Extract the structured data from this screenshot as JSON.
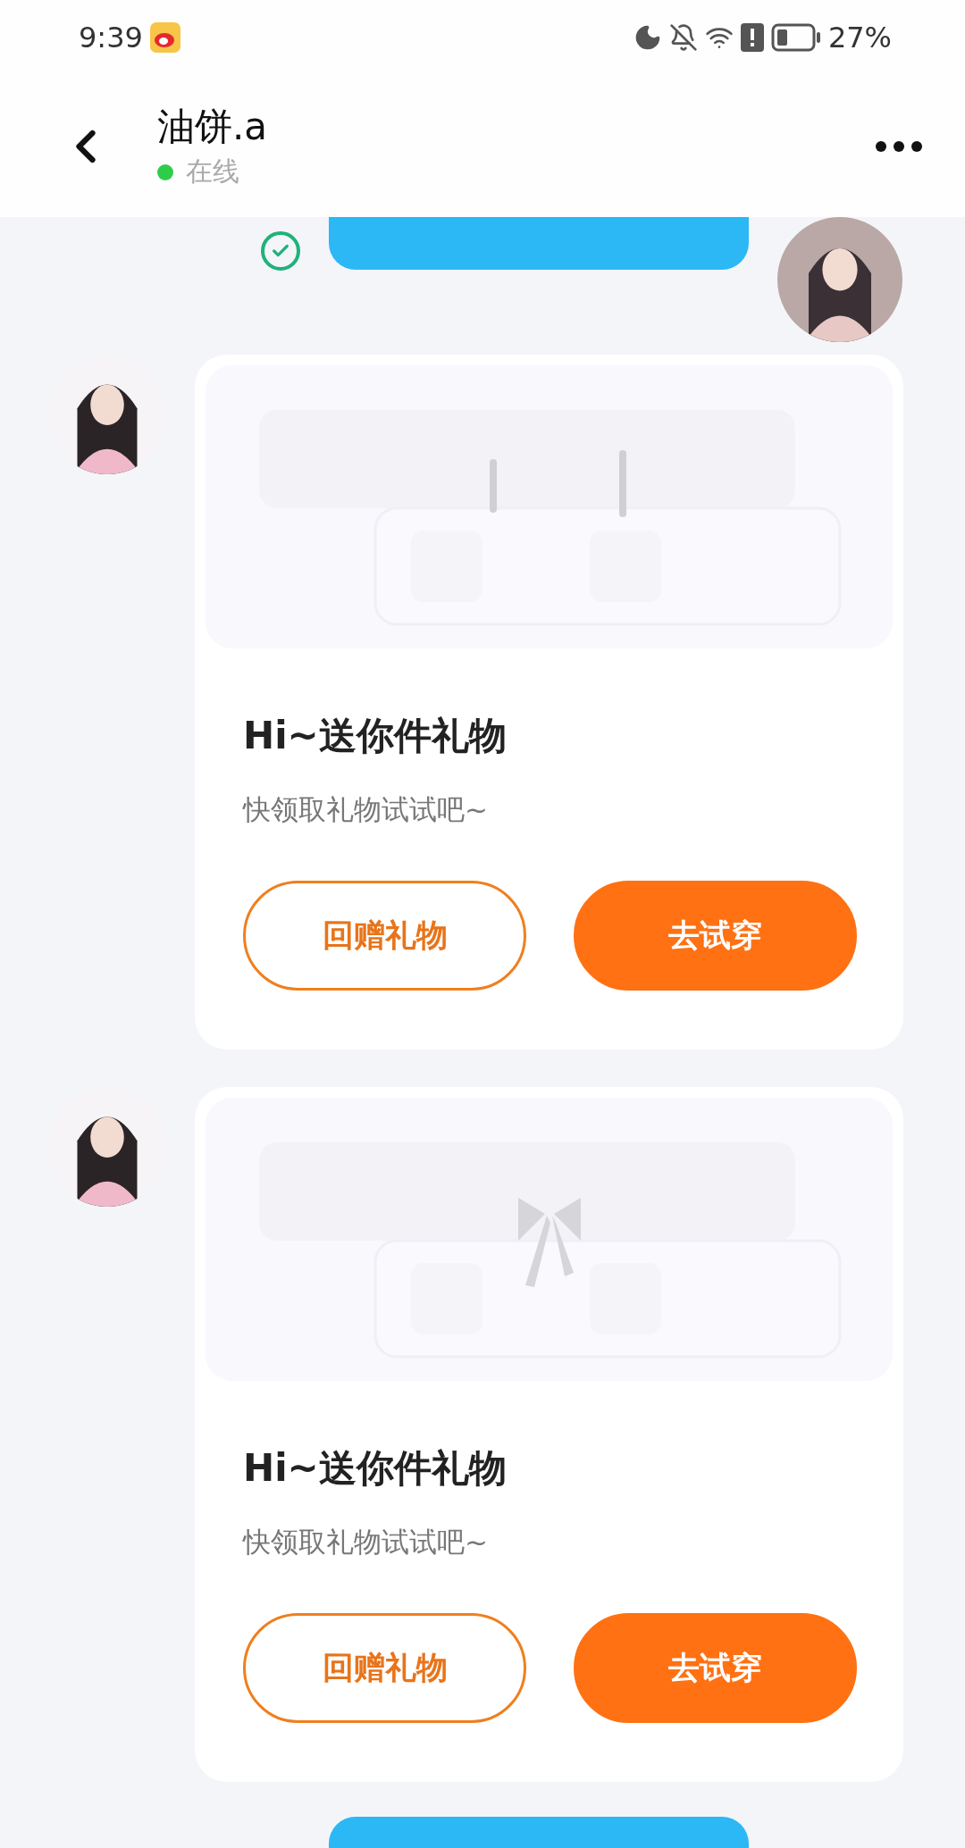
{
  "status_bar": {
    "time": "9:39",
    "battery": "27%"
  },
  "header": {
    "name": "油饼.a",
    "status": "在线",
    "online": true
  },
  "messages": [
    {
      "kind": "sent_bubble",
      "delivered": true
    },
    {
      "kind": "gift_card",
      "title": "Hi~送你件礼物",
      "subtitle": "快领取礼物试试吧~",
      "buttons": [
        {
          "label": "回赠礼物",
          "kind": "outline"
        },
        {
          "label": "去试穿",
          "kind": "filled"
        }
      ]
    },
    {
      "kind": "gift_card",
      "title": "Hi~送你件礼物",
      "subtitle": "快领取礼物试试吧~",
      "buttons": [
        {
          "label": "回赠礼物",
          "kind": "outline"
        },
        {
          "label": "去试穿",
          "kind": "filled"
        }
      ]
    },
    {
      "kind": "sent_bubble"
    }
  ]
}
